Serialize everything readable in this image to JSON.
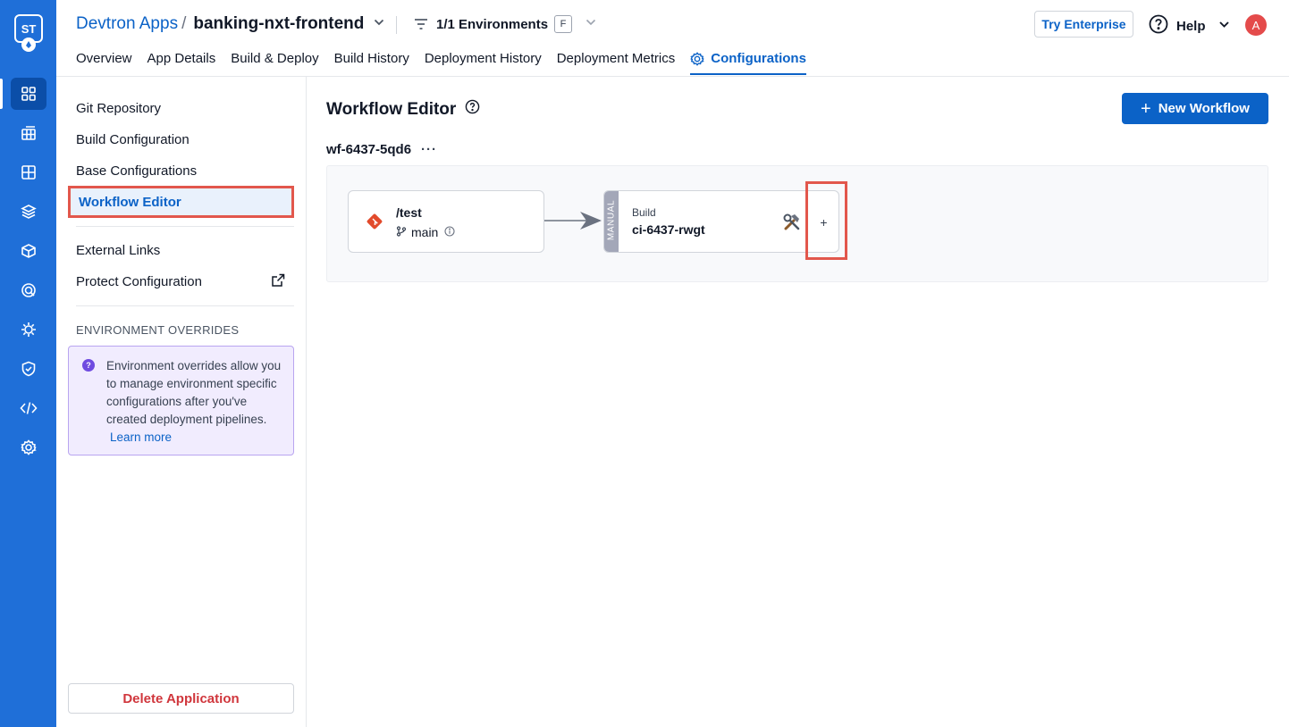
{
  "rail": {
    "logo_text": "ST",
    "items": [
      "apps-icon",
      "application-groups-icon",
      "chart-store-icon",
      "resource-browser-icon",
      "cube-icon",
      "security-icon",
      "gear-cluster-icon",
      "shield-check-icon",
      "code-icon",
      "settings-icon"
    ],
    "active_index": 0,
    "color": "#1f6fd8"
  },
  "header": {
    "breadcrumb_root": "Devtron Apps",
    "breadcrumb_sep": "/",
    "app_name": "banking-nxt-frontend",
    "environments_label": "1/1 Environments",
    "environment_badge": "F",
    "try_enterprise": "Try Enterprise",
    "help_label": "Help",
    "avatar_initial": "A",
    "tabs": [
      {
        "label": "Overview"
      },
      {
        "label": "App Details"
      },
      {
        "label": "Build & Deploy"
      },
      {
        "label": "Build History"
      },
      {
        "label": "Deployment History"
      },
      {
        "label": "Deployment Metrics"
      },
      {
        "label": "Configurations"
      }
    ],
    "active_tab": "Configurations",
    "accent": "#0b62c7"
  },
  "sidebar": {
    "items": [
      {
        "label": "Git Repository"
      },
      {
        "label": "Build Configuration"
      },
      {
        "label": "Base Configurations"
      },
      {
        "label": "Workflow Editor"
      }
    ],
    "active_item": "Workflow Editor",
    "extra_items": [
      {
        "label": "External Links"
      },
      {
        "label": "Protect Configuration"
      }
    ],
    "env_overrides_heading": "ENVIRONMENT OVERRIDES",
    "env_note_text": "Environment overrides allow you to manage environment specific configurations after you've created deployment pipelines.",
    "env_note_link": "Learn more",
    "delete_button": "Delete Application",
    "danger_color": "#d0363c"
  },
  "main": {
    "title": "Workflow Editor",
    "new_workflow_button": "New Workflow",
    "workflow": {
      "name": "wf-6437-5qd6",
      "menu_dots": "···",
      "source": {
        "path": "/test",
        "branch": "main"
      },
      "build": {
        "trigger": "MANUAL",
        "label": "Build",
        "name": "ci-6437-rwgt"
      },
      "add_button": "+"
    }
  }
}
